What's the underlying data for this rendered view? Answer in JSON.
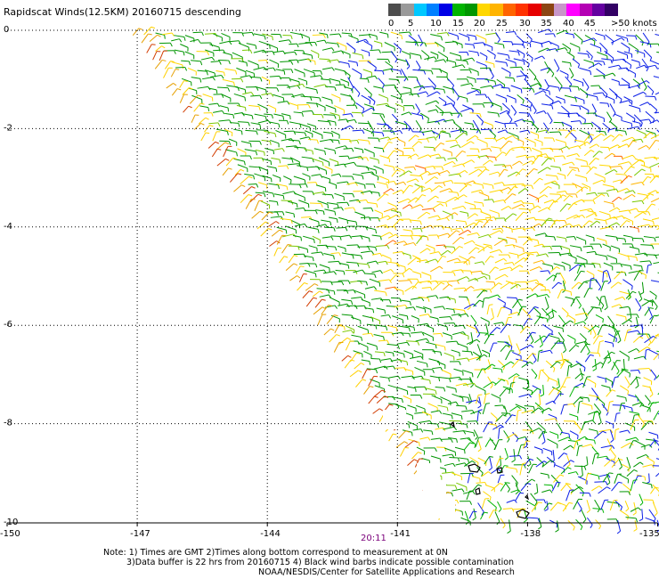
{
  "title": "Rapidscat Winds(12.5KM) 20160715 descending",
  "legend": {
    "colors": [
      "#4d4d4d",
      "#9a9a9a",
      "#00c8ff",
      "#0080ff",
      "#0000e6",
      "#00b400",
      "#009600",
      "#ffd700",
      "#ffb400",
      "#ff6400",
      "#ff3200",
      "#e60000",
      "#8b4513",
      "#c896c8",
      "#ff00ff",
      "#b400b4",
      "#6400a0",
      "#320064"
    ],
    "labels": [
      "0",
      "5",
      "10",
      "15",
      "20",
      "25",
      "30",
      "35",
      "40",
      "45",
      ">50 knots"
    ]
  },
  "axes": {
    "x_labels": [
      "-150",
      "-147",
      "-144",
      "-141",
      "-138",
      "-135"
    ],
    "y_labels": [
      "0",
      "-2",
      "-4",
      "-6",
      "-8",
      "-10"
    ]
  },
  "time_label": "20:11",
  "notes": [
    "Note: 1) Times are GMT 2)Times along bottom correspond to measurement at 0N",
    "3)Data buffer is 22 hrs from 20160715 4) Black wind barbs indicate possible contamination",
    "NOAA/NESDIS/Center for Satellite Applications and Research"
  ]
}
